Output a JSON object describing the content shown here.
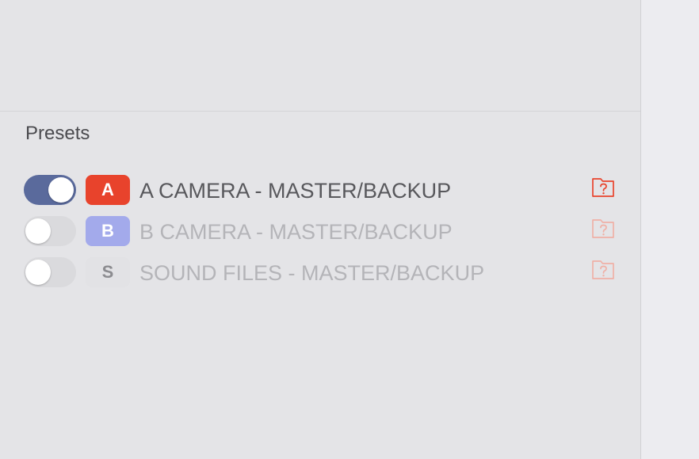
{
  "presets_section": {
    "title": "Presets",
    "items": [
      {
        "enabled": true,
        "badge_letter": "A",
        "badge_color": "#e8432c",
        "label": "A CAMERA - MASTER/BACKUP",
        "label_color": "#58585c",
        "folder_icon": "folder-question-icon",
        "folder_icon_color": "#e8432c"
      },
      {
        "enabled": false,
        "badge_letter": "B",
        "badge_color": "#a3aaeb",
        "label": "B CAMERA - MASTER/BACKUP",
        "label_color": "#b4b4b8",
        "folder_icon": "folder-question-icon",
        "folder_icon_color": "#efb0a6"
      },
      {
        "enabled": false,
        "badge_letter": "S",
        "badge_color": "#e2e2e5",
        "label": "SOUND FILES - MASTER/BACKUP",
        "label_color": "#b4b4b8",
        "folder_icon": "folder-question-icon",
        "folder_icon_color": "#efb0a6"
      }
    ]
  },
  "colors": {
    "toggle_on": "#5a6a9c",
    "toggle_off": "#dadadd",
    "background": "#e4e4e7",
    "badge_letter_muted": "#8c8c90"
  }
}
